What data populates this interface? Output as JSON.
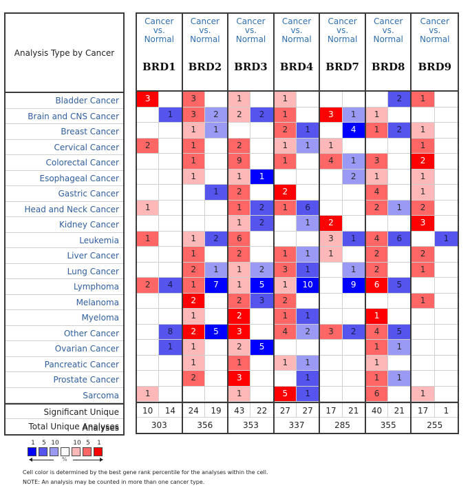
{
  "chart_data": {
    "type": "heatmap",
    "title": "",
    "corner_label": "Analysis Type by Cancer",
    "analysis_type": "Cancer vs. Normal",
    "analysis_lines": [
      "Cancer",
      "vs.",
      "Normal"
    ],
    "genes": [
      "BRD1",
      "BRD2",
      "BRD3",
      "BRD4",
      "BRD7",
      "BRD8",
      "BRD9"
    ],
    "cancers": [
      "Bladder Cancer",
      "Brain and CNS Cancer",
      "Breast Cancer",
      "Cervical Cancer",
      "Colorectal Cancer",
      "Esophageal Cancer",
      "Gastric Cancer",
      "Head and Neck Cancer",
      "Kidney Cancer",
      "Leukemia",
      "Liver Cancer",
      "Lung Cancer",
      "Lymphoma",
      "Melanoma",
      "Myeloma",
      "Other Cancer",
      "Ovarian Cancer",
      "Pancreatic Cancer",
      "Prostate Cancer",
      "Sarcoma"
    ],
    "color_key": "each cell: [count, percentile level]; up = red (overexpression), down = blue (underexpression); level 1 = top 1%, 5 = top 5%, 10 = top 10%",
    "cells": {
      "BRD1": {
        "up": [
          [
            3,
            1
          ],
          null,
          null,
          [
            2,
            5
          ],
          null,
          null,
          null,
          [
            1,
            10
          ],
          null,
          [
            1,
            5
          ],
          null,
          null,
          [
            2,
            5
          ],
          null,
          null,
          null,
          null,
          null,
          null,
          [
            1,
            10
          ]
        ],
        "down": [
          null,
          [
            1,
            5
          ],
          null,
          null,
          null,
          null,
          null,
          null,
          null,
          null,
          null,
          null,
          [
            4,
            5
          ],
          null,
          null,
          [
            8,
            5
          ],
          [
            1,
            5
          ],
          null,
          null,
          null
        ]
      },
      "BRD2": {
        "up": [
          [
            3,
            5
          ],
          [
            3,
            5
          ],
          [
            1,
            10
          ],
          [
            1,
            5
          ],
          [
            1,
            5
          ],
          [
            1,
            10
          ],
          null,
          null,
          null,
          [
            1,
            10
          ],
          [
            1,
            5
          ],
          [
            2,
            5
          ],
          [
            1,
            5
          ],
          [
            2,
            1
          ],
          [
            1,
            10
          ],
          [
            2,
            1
          ],
          [
            1,
            10
          ],
          [
            1,
            10
          ],
          [
            2,
            5
          ],
          null
        ],
        "down": [
          null,
          [
            2,
            10
          ],
          [
            1,
            10
          ],
          null,
          null,
          null,
          [
            1,
            5
          ],
          null,
          null,
          [
            2,
            5
          ],
          null,
          [
            1,
            10
          ],
          [
            7,
            1
          ],
          null,
          null,
          [
            5,
            1
          ],
          null,
          null,
          null,
          null
        ]
      },
      "BRD3": {
        "up": [
          [
            1,
            10
          ],
          [
            2,
            10
          ],
          null,
          [
            2,
            5
          ],
          [
            9,
            5
          ],
          [
            1,
            10
          ],
          [
            2,
            5
          ],
          [
            1,
            5
          ],
          [
            1,
            10
          ],
          [
            6,
            5
          ],
          [
            2,
            5
          ],
          [
            1,
            10
          ],
          [
            1,
            10
          ],
          [
            2,
            5
          ],
          [
            2,
            1
          ],
          [
            3,
            1
          ],
          [
            2,
            10
          ],
          [
            1,
            5
          ],
          [
            3,
            1
          ],
          [
            1,
            10
          ]
        ],
        "down": [
          null,
          [
            2,
            5
          ],
          null,
          null,
          null,
          [
            1,
            1
          ],
          null,
          [
            2,
            5
          ],
          [
            2,
            5
          ],
          null,
          null,
          [
            2,
            10
          ],
          [
            5,
            1
          ],
          [
            3,
            5
          ],
          null,
          null,
          [
            5,
            1
          ],
          null,
          null,
          null
        ]
      },
      "BRD4": {
        "up": [
          [
            1,
            10
          ],
          [
            1,
            5
          ],
          [
            2,
            5
          ],
          [
            1,
            10
          ],
          [
            1,
            5
          ],
          null,
          [
            2,
            1
          ],
          [
            1,
            5
          ],
          null,
          null,
          [
            1,
            5
          ],
          [
            3,
            5
          ],
          [
            1,
            10
          ],
          [
            2,
            5
          ],
          [
            1,
            5
          ],
          [
            4,
            5
          ],
          null,
          [
            1,
            10
          ],
          null,
          [
            5,
            1
          ]
        ],
        "down": [
          null,
          null,
          [
            1,
            5
          ],
          [
            1,
            10
          ],
          null,
          null,
          null,
          [
            6,
            5
          ],
          [
            1,
            10
          ],
          null,
          [
            1,
            10
          ],
          [
            1,
            5
          ],
          [
            10,
            1
          ],
          null,
          [
            1,
            5
          ],
          [
            2,
            10
          ],
          null,
          [
            1,
            10
          ],
          [
            1,
            5
          ],
          [
            1,
            5
          ]
        ]
      },
      "BRD7": {
        "up": [
          null,
          [
            3,
            1
          ],
          null,
          [
            1,
            10
          ],
          [
            4,
            5
          ],
          null,
          null,
          null,
          [
            2,
            1
          ],
          [
            3,
            10
          ],
          [
            1,
            10
          ],
          null,
          null,
          null,
          null,
          [
            3,
            5
          ],
          null,
          null,
          null,
          null
        ],
        "down": [
          null,
          [
            1,
            10
          ],
          [
            4,
            1
          ],
          null,
          [
            1,
            10
          ],
          [
            2,
            10
          ],
          null,
          null,
          null,
          [
            1,
            5
          ],
          null,
          [
            1,
            10
          ],
          [
            9,
            1
          ],
          null,
          null,
          [
            2,
            5
          ],
          null,
          null,
          null,
          null
        ]
      },
      "BRD8": {
        "up": [
          null,
          [
            1,
            10
          ],
          [
            1,
            5
          ],
          null,
          [
            3,
            5
          ],
          [
            1,
            10
          ],
          [
            4,
            5
          ],
          [
            2,
            5
          ],
          null,
          [
            4,
            5
          ],
          [
            2,
            5
          ],
          [
            2,
            5
          ],
          [
            6,
            1
          ],
          null,
          [
            1,
            1
          ],
          [
            4,
            5
          ],
          [
            1,
            5
          ],
          [
            1,
            10
          ],
          [
            1,
            5
          ],
          [
            6,
            5
          ]
        ],
        "down": [
          [
            2,
            5
          ],
          null,
          [
            2,
            5
          ],
          null,
          null,
          null,
          null,
          [
            1,
            10
          ],
          null,
          [
            6,
            5
          ],
          null,
          null,
          [
            5,
            5
          ],
          null,
          null,
          [
            5,
            5
          ],
          [
            1,
            10
          ],
          null,
          [
            1,
            10
          ],
          null
        ]
      },
      "BRD9": {
        "up": [
          [
            1,
            5
          ],
          null,
          [
            1,
            10
          ],
          [
            1,
            5
          ],
          [
            2,
            1
          ],
          [
            1,
            10
          ],
          [
            1,
            10
          ],
          [
            2,
            5
          ],
          [
            3,
            1
          ],
          null,
          [
            2,
            5
          ],
          [
            1,
            5
          ],
          null,
          [
            1,
            5
          ],
          null,
          null,
          null,
          null,
          null,
          [
            1,
            10
          ]
        ],
        "down": [
          null,
          null,
          null,
          null,
          null,
          null,
          null,
          null,
          null,
          [
            1,
            5
          ],
          null,
          null,
          null,
          null,
          null,
          null,
          null,
          null,
          null,
          null
        ]
      }
    },
    "summary": {
      "significant_label": "Significant Unique Analyses",
      "total_label": "Total Unique Analyses",
      "significant": [
        [
          10,
          14
        ],
        [
          24,
          19
        ],
        [
          43,
          22
        ],
        [
          27,
          27
        ],
        [
          17,
          21
        ],
        [
          40,
          21
        ],
        [
          17,
          1
        ]
      ],
      "total": [
        303,
        356,
        353,
        337,
        285,
        355,
        255
      ]
    },
    "colors": {
      "up": {
        "1": "#ff0000",
        "5": "#ff6666",
        "10": "#ffb8b8"
      },
      "down": {
        "1": "#0000ff",
        "5": "#5555ee",
        "10": "#9a9af5"
      },
      "none": "#ffffff"
    }
  },
  "legend": {
    "numbers": [
      "1",
      "5",
      "10",
      "",
      "10",
      "5",
      "1"
    ],
    "unit": "%",
    "note1": "Cell color is determined by the best gene rank percentile for the analyses within the cell.",
    "note2": "NOTE: An analysis may be counted in more than one cancer type."
  }
}
